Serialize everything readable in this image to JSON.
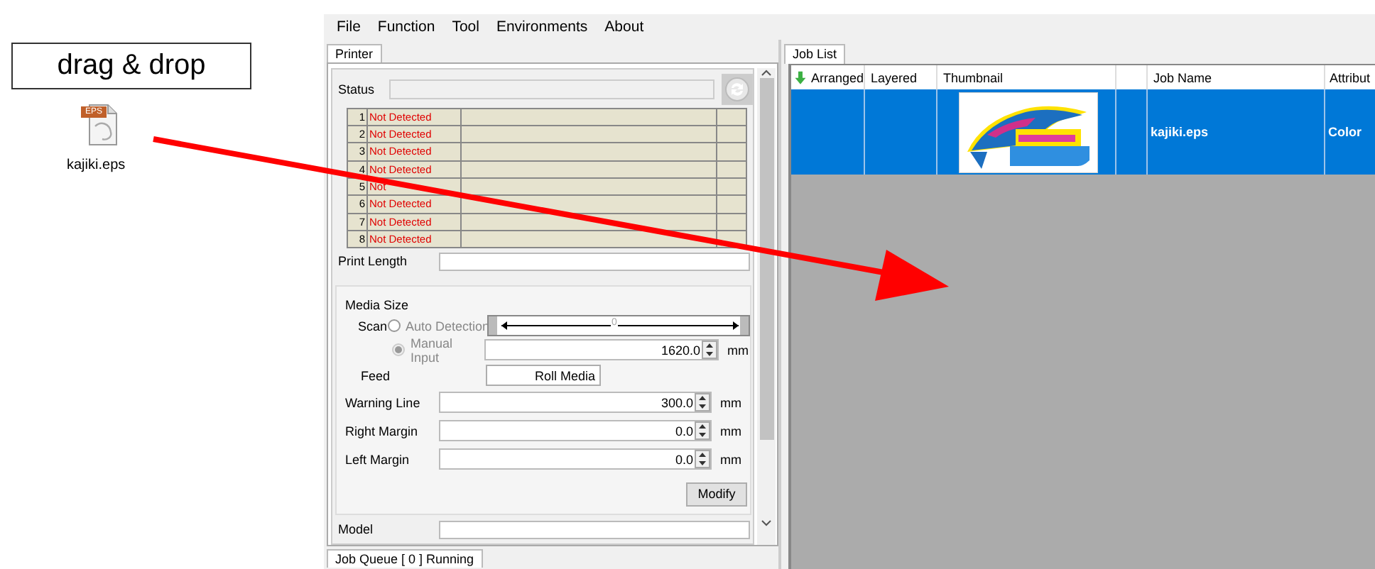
{
  "annotation": {
    "label": "drag & drop",
    "file": {
      "badge": "EPS",
      "name": "kajiki.eps"
    }
  },
  "menu": [
    "File",
    "Function",
    "Tool",
    "Environments",
    "About"
  ],
  "printer_panel": {
    "tab": {
      "label": "Printer",
      "selected": true
    },
    "status_label": "Status",
    "printers": [
      {
        "number": "1",
        "status": "Not Detected"
      },
      {
        "number": "2",
        "status": "Not Detected"
      },
      {
        "number": "3",
        "status": "Not Detected"
      },
      {
        "number": "4",
        "status": "Not Detected"
      },
      {
        "number": "5",
        "status": "Not"
      },
      {
        "number": "6",
        "status": "Not Detected"
      },
      {
        "number": "7",
        "status": "Not Detected"
      },
      {
        "number": "8",
        "status": "Not Detected"
      }
    ],
    "print_length_label": "Print Length",
    "media_size": {
      "title": "Media Size",
      "scan_label": "Scan",
      "options": [
        {
          "label": "Auto Detection",
          "selected": false,
          "disabled": false
        },
        {
          "label": "Manual Input",
          "selected": true,
          "disabled": true
        }
      ],
      "slider_reading": "0",
      "manual_value": "1620.0",
      "unit": "mm",
      "feed_label": "Feed",
      "feed_value": "Roll Media"
    },
    "margins": [
      {
        "label": "Warning Line",
        "value": "300.0",
        "unit": "mm"
      },
      {
        "label": "Right Margin",
        "value": "0.0",
        "unit": "mm"
      },
      {
        "label": "Left Margin",
        "value": "0.0",
        "unit": "mm"
      }
    ],
    "modify_button": "Modify",
    "model_label": "Model"
  },
  "bottom_tabs": [
    {
      "label": "Job Queue [ 0 ] Running",
      "selected": true
    }
  ],
  "job_list": {
    "tab": {
      "label": "Job List",
      "selected": true
    },
    "columns": [
      "Arranged",
      "Layered",
      "Thumbnail",
      "Job Name",
      "Attribut"
    ],
    "rows": [
      {
        "selected": true,
        "job_name": "kajiki.eps",
        "attribute": "Color"
      }
    ]
  }
}
